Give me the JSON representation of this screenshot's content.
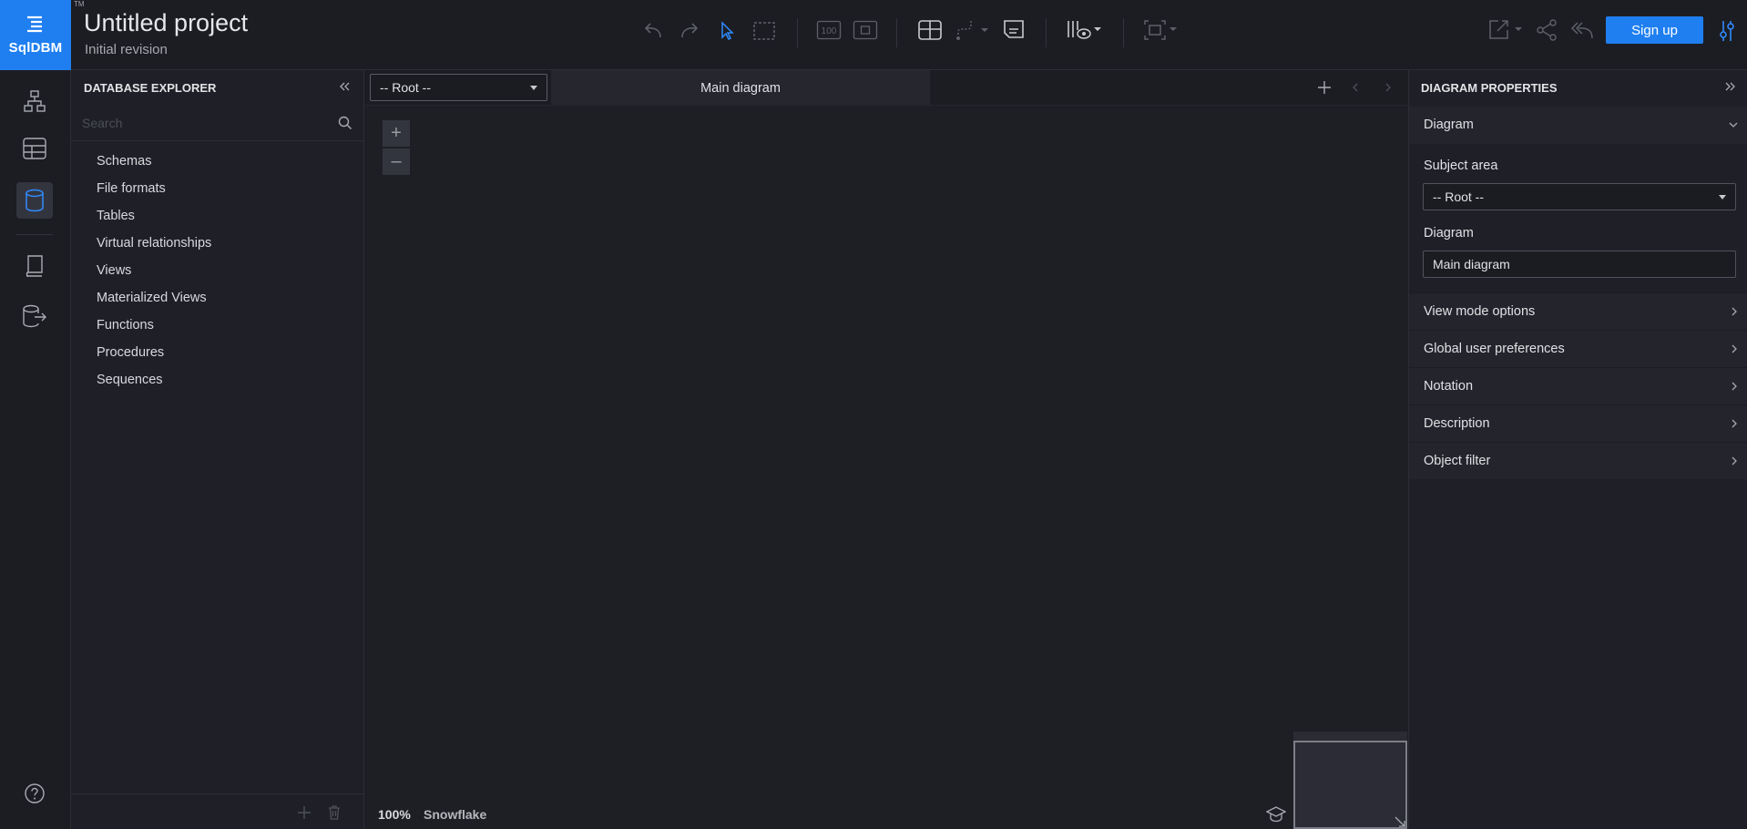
{
  "app": {
    "logo_text": "SqlDBM",
    "trademark": "TM",
    "project_title": "Untitled project",
    "project_subtitle": "Initial revision"
  },
  "toolbar": {
    "icons": [
      "undo-icon",
      "redo-icon",
      "select-pointer-icon",
      "marquee-select-icon",
      "zoom-100-icon",
      "fit-to-screen-icon",
      "add-table-icon",
      "add-relationship-icon",
      "add-note-icon",
      "view-options-icon",
      "layout-icon",
      "export-icon",
      "share-icon",
      "version-history-icon",
      "settings-icon"
    ],
    "zoom_100_label": "100",
    "signup_label": "Sign up"
  },
  "rail": {
    "items": [
      "diagram-tree-icon",
      "table-grid-icon",
      "database-icon",
      "documentation-icon",
      "database-export-icon"
    ],
    "active": "database-icon",
    "help_icon": "help-icon"
  },
  "explorer": {
    "title": "DATABASE EXPLORER",
    "search_placeholder": "Search",
    "items": [
      "Schemas",
      "File formats",
      "Tables",
      "Virtual relationships",
      "Views",
      "Materialized Views",
      "Functions",
      "Procedures",
      "Sequences"
    ]
  },
  "canvas": {
    "subject_area": "-- Root --",
    "diagram_tab": "Main diagram",
    "zoom_plus": "+",
    "zoom_minus": "–",
    "zoom_level": "100%",
    "database": "Snowflake"
  },
  "properties": {
    "title": "DIAGRAM PROPERTIES",
    "section": "Diagram",
    "subject_area_label": "Subject area",
    "subject_area_value": "-- Root --",
    "diagram_label": "Diagram",
    "diagram_value": "Main diagram",
    "rows": [
      "View mode options",
      "Global user preferences",
      "Notation",
      "Description",
      "Object filter"
    ]
  },
  "colors": {
    "accent": "#1f7ff0",
    "background": "#1e1f25",
    "panel": "#1f2027"
  }
}
